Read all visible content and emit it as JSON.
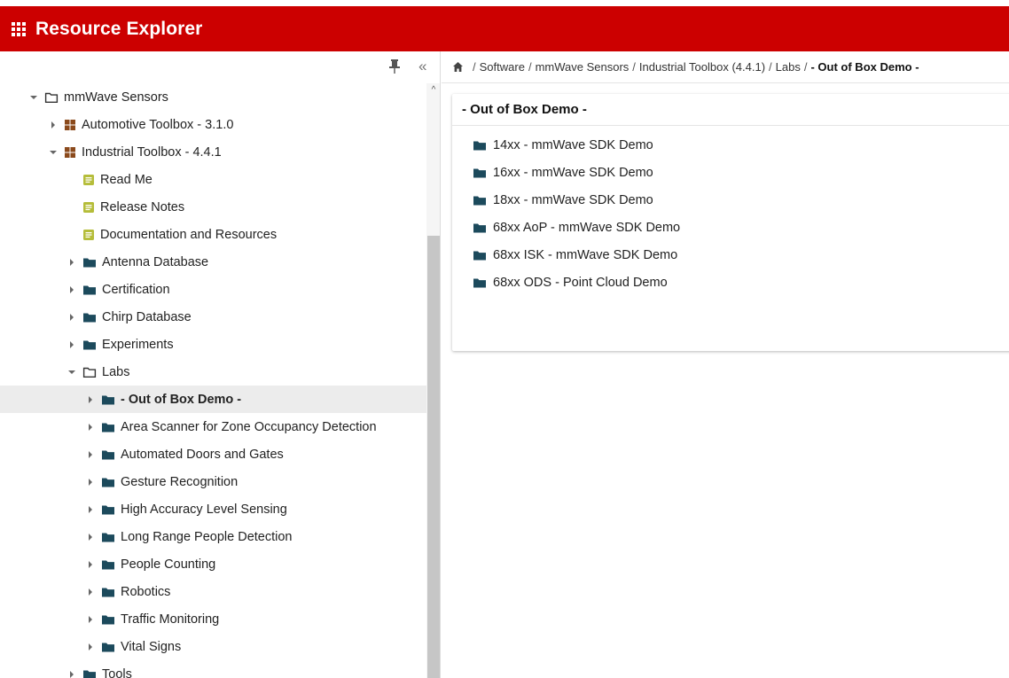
{
  "app": {
    "title": "Resource Explorer",
    "brand_color": "#cc0000",
    "menu_icon": "apps-grid-icon"
  },
  "sidebar": {
    "pin_icon": "pin-icon",
    "collapse_label": "«",
    "scroll_up_label": "^",
    "selected_item": "- Out of Box Demo -",
    "items": [
      {
        "label": "mmWave Sensors",
        "icon": "folder-open-icon",
        "expand": "expanded"
      },
      {
        "label": "Automotive Toolbox - 3.1.0",
        "icon": "package-icon",
        "expand": "collapsed"
      },
      {
        "label": "Industrial Toolbox - 4.4.1",
        "icon": "package-icon",
        "expand": "expanded"
      },
      {
        "label": "Read Me",
        "icon": "document-icon",
        "expand": "none"
      },
      {
        "label": "Release Notes",
        "icon": "document-icon",
        "expand": "none"
      },
      {
        "label": "Documentation and Resources",
        "icon": "document-icon",
        "expand": "none"
      },
      {
        "label": "Antenna Database",
        "icon": "folder-icon",
        "expand": "collapsed"
      },
      {
        "label": "Certification",
        "icon": "folder-icon",
        "expand": "collapsed"
      },
      {
        "label": "Chirp Database",
        "icon": "folder-icon",
        "expand": "collapsed"
      },
      {
        "label": "Experiments",
        "icon": "folder-icon",
        "expand": "collapsed"
      },
      {
        "label": "Labs",
        "icon": "folder-open-icon",
        "expand": "expanded"
      },
      {
        "label": "- Out of Box Demo -",
        "icon": "folder-icon",
        "expand": "collapsed"
      },
      {
        "label": "Area Scanner for Zone Occupancy Detection",
        "icon": "folder-icon",
        "expand": "collapsed"
      },
      {
        "label": "Automated Doors and Gates",
        "icon": "folder-icon",
        "expand": "collapsed"
      },
      {
        "label": "Gesture Recognition",
        "icon": "folder-icon",
        "expand": "collapsed"
      },
      {
        "label": "High Accuracy Level Sensing",
        "icon": "folder-icon",
        "expand": "collapsed"
      },
      {
        "label": "Long Range People Detection",
        "icon": "folder-icon",
        "expand": "collapsed"
      },
      {
        "label": "People Counting",
        "icon": "folder-icon",
        "expand": "collapsed"
      },
      {
        "label": "Robotics",
        "icon": "folder-icon",
        "expand": "collapsed"
      },
      {
        "label": "Traffic Monitoring",
        "icon": "folder-icon",
        "expand": "collapsed"
      },
      {
        "label": "Vital Signs",
        "icon": "folder-icon",
        "expand": "collapsed"
      },
      {
        "label": "Tools",
        "icon": "folder-icon",
        "expand": "collapsed"
      }
    ]
  },
  "breadcrumb": {
    "home_icon": "home-icon",
    "separator": "/",
    "items": [
      "Software",
      "mmWave Sensors",
      "Industrial Toolbox (4.4.1)",
      "Labs"
    ],
    "current": "- Out of Box Demo -"
  },
  "content": {
    "title": "- Out of Box Demo -",
    "items": [
      {
        "label": "14xx - mmWave SDK Demo",
        "icon": "folder-icon"
      },
      {
        "label": "16xx - mmWave SDK Demo",
        "icon": "folder-icon"
      },
      {
        "label": "18xx - mmWave SDK Demo",
        "icon": "folder-icon"
      },
      {
        "label": "68xx AoP - mmWave SDK Demo",
        "icon": "folder-icon"
      },
      {
        "label": "68xx ISK - mmWave SDK Demo",
        "icon": "folder-icon"
      },
      {
        "label": "68xx ODS - Point Cloud Demo",
        "icon": "folder-icon"
      }
    ]
  },
  "colors": {
    "folder": "#1c4a5c",
    "package": "#8b4a1c",
    "document": "#b5bd3a",
    "selected_row": "#ececec"
  }
}
